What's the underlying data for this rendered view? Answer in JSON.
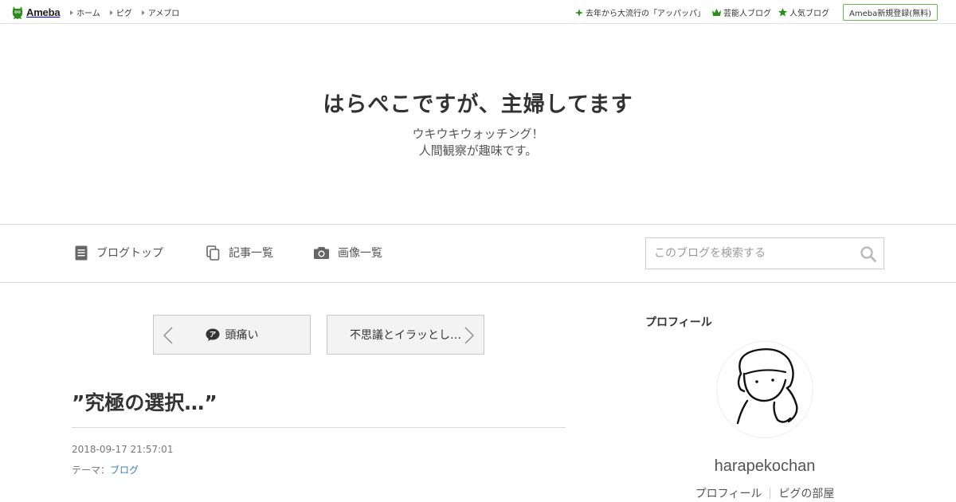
{
  "global_bar": {
    "logo_text": "Ameba",
    "nav": [
      {
        "label": "ホーム"
      },
      {
        "label": "ピグ"
      },
      {
        "label": "アメブロ"
      }
    ],
    "right_links": [
      {
        "label": "去年から大流行の「アッパッパ」",
        "icon": "sparkle-icon"
      },
      {
        "label": "芸能人ブログ",
        "icon": "crown-icon"
      },
      {
        "label": "人気ブログ",
        "icon": "star-icon"
      }
    ],
    "register_label": "Ameba新規登録(無料)"
  },
  "blog": {
    "title": "はらぺこですが、主婦してます",
    "description_line1": "ウキウキウォッチング！",
    "description_line2": "人間観察が趣味です。"
  },
  "blog_nav": {
    "top_label": "ブログトップ",
    "entries_label": "記事一覧",
    "images_label": "画像一覧",
    "search_placeholder": "このブログを検索する"
  },
  "pager": {
    "prev_label": "頭痛い",
    "next_label": "不思議とイラッとし…"
  },
  "entry": {
    "title": "”究極の選択…”",
    "date": "2018-09-17 21:57:01",
    "theme_prefix": "テーマ：",
    "theme": "ブログ"
  },
  "sidebar": {
    "heading": "プロフィール",
    "name": "harapekochan",
    "profile_link": "プロフィール",
    "pig_room_link": "ピグの部屋"
  },
  "colors": {
    "brand_green": "#2d8c1e",
    "link_blue": "#3c7cc0"
  }
}
